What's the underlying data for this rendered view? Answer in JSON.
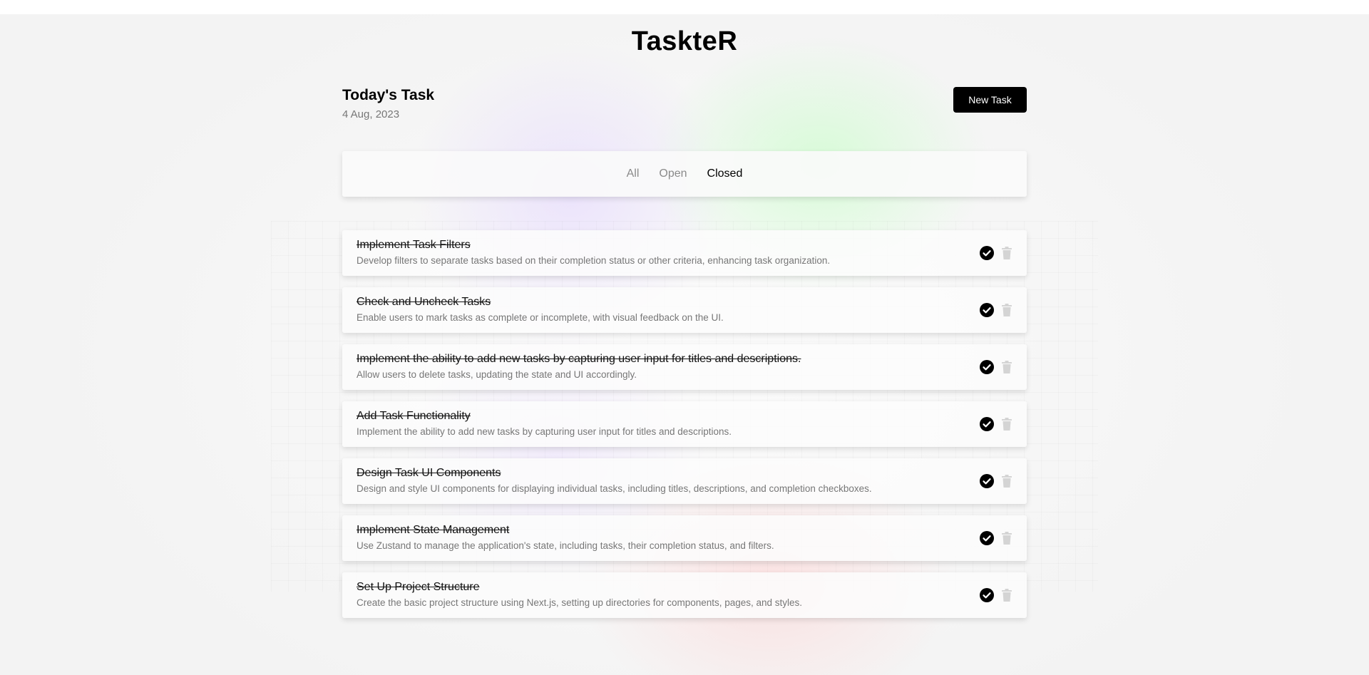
{
  "app": {
    "title": "TaskteR"
  },
  "header": {
    "title": "Today's Task",
    "date": "4 Aug, 2023",
    "new_task_label": "New Task"
  },
  "filters": {
    "tabs": [
      {
        "label": "All",
        "active": false
      },
      {
        "label": "Open",
        "active": false
      },
      {
        "label": "Closed",
        "active": true
      }
    ]
  },
  "tasks": [
    {
      "title": "Implement Task Filters",
      "description": "Develop filters to separate tasks based on their completion status or other criteria, enhancing task organization.",
      "completed": true
    },
    {
      "title": "Check and Uncheck Tasks",
      "description": "Enable users to mark tasks as complete or incomplete, with visual feedback on the UI.",
      "completed": true
    },
    {
      "title": "Implement the ability to add new tasks by capturing user input for titles and descriptions.",
      "description": "Allow users to delete tasks, updating the state and UI accordingly.",
      "completed": true
    },
    {
      "title": "Add Task Functionality",
      "description": "Implement the ability to add new tasks by capturing user input for titles and descriptions.",
      "completed": true
    },
    {
      "title": "Design Task UI Components",
      "description": "Design and style UI components for displaying individual tasks, including titles, descriptions, and completion checkboxes.",
      "completed": true
    },
    {
      "title": "Implement State Management",
      "description": "Use Zustand to manage the application's state, including tasks, their completion status, and filters.",
      "completed": true
    },
    {
      "title": "Set Up Project Structure",
      "description": "Create the basic project structure using Next.js, setting up directories for components, pages, and styles.",
      "completed": true
    }
  ],
  "icons": {
    "check": "check-circle-icon",
    "delete": "trash-icon"
  },
  "colors": {
    "primary": "#000000",
    "muted_text": "#777777",
    "trash_icon": "#d4d4d4"
  }
}
